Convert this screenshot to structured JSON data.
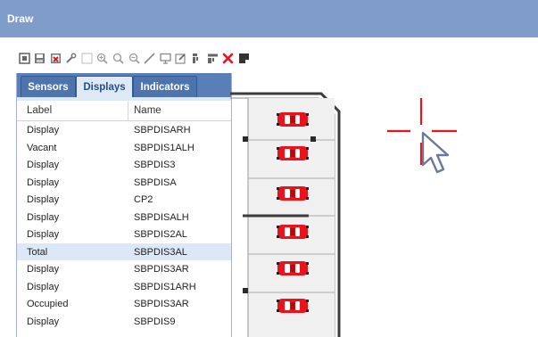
{
  "window": {
    "title": "Draw"
  },
  "toolbar": {
    "tools": [
      {
        "name": "select-icon"
      },
      {
        "name": "save-icon"
      },
      {
        "name": "delete-file-icon"
      },
      {
        "name": "wrench-icon"
      },
      {
        "name": "grid-icon"
      },
      {
        "name": "zoom-in-icon"
      },
      {
        "name": "zoom-reset-icon"
      },
      {
        "name": "zoom-out-icon"
      },
      {
        "name": "line-icon"
      },
      {
        "name": "monitor-icon"
      },
      {
        "name": "edit-icon"
      },
      {
        "name": "align-left-icon"
      },
      {
        "name": "align-top-icon"
      },
      {
        "name": "close-red-icon"
      },
      {
        "name": "fill-icon"
      }
    ]
  },
  "tabs": [
    {
      "label": "Sensors",
      "active": false
    },
    {
      "label": "Displays",
      "active": true
    },
    {
      "label": "Indicators",
      "active": false
    }
  ],
  "table": {
    "columns": [
      "Label",
      "Name"
    ],
    "rows": [
      {
        "label": "Display",
        "name": "SBPDISARH"
      },
      {
        "label": "Vacant",
        "name": "SBPDIS1ALH"
      },
      {
        "label": "Display",
        "name": "SBPDIS3"
      },
      {
        "label": "Display",
        "name": "SBPDISA"
      },
      {
        "label": "Display",
        "name": "CP2"
      },
      {
        "label": "Display",
        "name": "SBPDISALH"
      },
      {
        "label": "Display",
        "name": "SBPDIS2AL"
      },
      {
        "label": "Total",
        "name": "SBPDIS3AL",
        "selected": true
      },
      {
        "label": "Display",
        "name": "SBPDIS3AR"
      },
      {
        "label": "Display",
        "name": "SBPDIS1ARH"
      },
      {
        "label": "Occupied",
        "name": "SBPDIS3AR"
      },
      {
        "label": "Display",
        "name": "SBPDIS9"
      }
    ]
  },
  "colors": {
    "titlebar": "#7f9ccb",
    "tab_active": "#dfe9f6",
    "car": "#e8141b",
    "crosshair": "#e8141b"
  }
}
